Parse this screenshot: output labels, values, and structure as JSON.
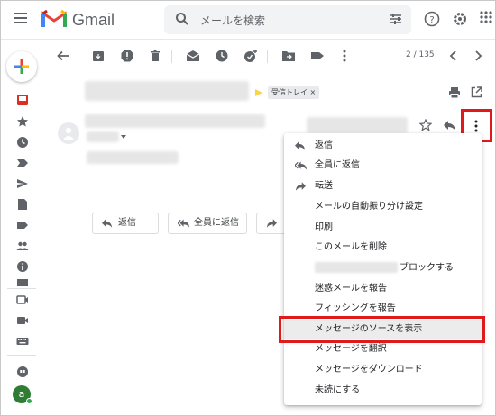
{
  "header": {
    "brand": "Gmail",
    "search_placeholder": "メールを検索"
  },
  "toolbar": {
    "page_count": "2 / 135"
  },
  "message": {
    "label": "受信トレイ ×"
  },
  "reply_buttons": {
    "reply": "返信",
    "reply_all": "全員に返信"
  },
  "menu": {
    "items": [
      {
        "label": "返信",
        "icon": "reply-icon"
      },
      {
        "label": "全員に返信",
        "icon": "reply-all-icon"
      },
      {
        "label": "転送",
        "icon": "forward-icon"
      },
      {
        "label": "メールの自動振り分け設定"
      },
      {
        "label": "印刷"
      },
      {
        "label": "このメールを削除"
      },
      {
        "label": "ブロックする"
      },
      {
        "label": "迷惑メールを報告"
      },
      {
        "label": "フィッシングを報告"
      },
      {
        "label": "メッセージのソースを表示",
        "highlighted": true
      },
      {
        "label": "メッセージを翻訳"
      },
      {
        "label": "メッセージをダウンロード"
      },
      {
        "label": "未読にする"
      }
    ]
  },
  "user": {
    "avatar_letter": "a"
  },
  "colors": {
    "highlight_red": "#e01a1a",
    "gmail_red": "#ea4335",
    "gmail_blue": "#4285f4",
    "gmail_green": "#34a853",
    "gmail_yellow": "#fbbc04"
  }
}
